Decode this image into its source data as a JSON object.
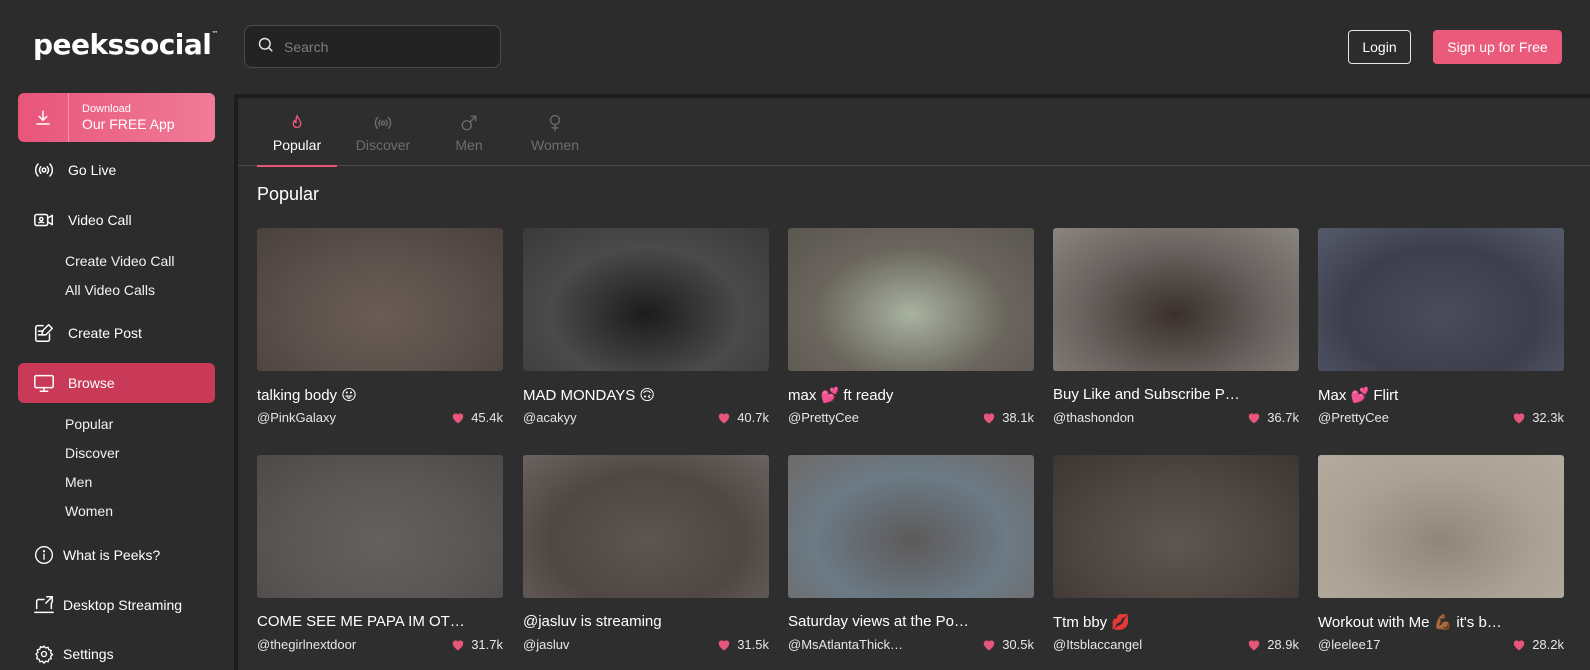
{
  "brand": {
    "logo_text": "peekssocial",
    "tm": "™"
  },
  "search": {
    "placeholder": "Search"
  },
  "header": {
    "login_label": "Login",
    "signup_label": "Sign up for Free"
  },
  "sidebar": {
    "download_small": "Download",
    "download_big": "Our FREE App",
    "go_live": "Go Live",
    "video_call": "Video Call",
    "video_call_sub": [
      "Create Video Call",
      "All Video Calls"
    ],
    "create_post": "Create Post",
    "browse": "Browse",
    "browse_sub": [
      "Popular",
      "Discover",
      "Men",
      "Women"
    ],
    "what_is": "What is Peeks?",
    "desktop_streaming": "Desktop Streaming",
    "settings": "Settings"
  },
  "tabs": [
    {
      "label": "Popular",
      "icon": "flame-icon",
      "active": true
    },
    {
      "label": "Discover",
      "icon": "broadcast-icon",
      "active": false
    },
    {
      "label": "Men",
      "icon": "male-icon",
      "active": false
    },
    {
      "label": "Women",
      "icon": "female-icon",
      "active": false
    }
  ],
  "section_title": "Popular",
  "colors": {
    "accent": "#e8557a",
    "active_nav": "#c83a57",
    "background": "#2c2c2c"
  },
  "streams": [
    {
      "title": "talking body 😛",
      "user": "@PinkGalaxy",
      "likes": "45.4k",
      "thumb": [
        "#5a4f4a",
        "#6b5d55",
        "#4a403c"
      ]
    },
    {
      "title": "MAD MONDAYS 🙃",
      "user": "@acakyy",
      "likes": "40.7k",
      "thumb": [
        "#4a4a4a",
        "#1c1c1c",
        "#3a3a3a"
      ]
    },
    {
      "title": "max 💕 ft ready",
      "user": "@PrettyCee",
      "likes": "38.1k",
      "thumb": [
        "#6a655d",
        "#a9b3a1",
        "#5a5650"
      ]
    },
    {
      "title": "Buy Like and Subscribe P…",
      "user": "@thashondon",
      "likes": "36.7k",
      "thumb": [
        "#6a6360",
        "#3a302c",
        "#8a8580"
      ]
    },
    {
      "title": "Max 💕 Flirt",
      "user": "@PrettyCee",
      "likes": "32.3k",
      "thumb": [
        "#3e3f4d",
        "#4a4b5b",
        "#555a6a"
      ]
    },
    {
      "title": "COME SEE ME PAPA IM OT…",
      "user": "@thegirlnextdoor",
      "likes": "31.7k",
      "thumb": [
        "#5a5655",
        "#656160",
        "#4d4948"
      ]
    },
    {
      "title": "@jasluv is streaming",
      "user": "@jasluv",
      "likes": "31.5k",
      "thumb": [
        "#4f4743",
        "#5d5550",
        "#6a6360"
      ]
    },
    {
      "title": "Saturday views at the Po…",
      "user": "@MsAtlantaThick…",
      "likes": "30.5k",
      "thumb": [
        "#6b7a85",
        "#5d5a5a",
        "#6f6a68"
      ]
    },
    {
      "title": "Ttm bby 💋",
      "user": "@Itsblaccangel",
      "likes": "28.9k",
      "thumb": [
        "#4d4540",
        "#5f5650",
        "#3c3530"
      ]
    },
    {
      "title": "Workout with Me 💪🏾 it's b…",
      "user": "@leelee17",
      "likes": "28.2k",
      "thumb": [
        "#a9a193",
        "#8f877a",
        "#b3ab9e"
      ]
    }
  ]
}
